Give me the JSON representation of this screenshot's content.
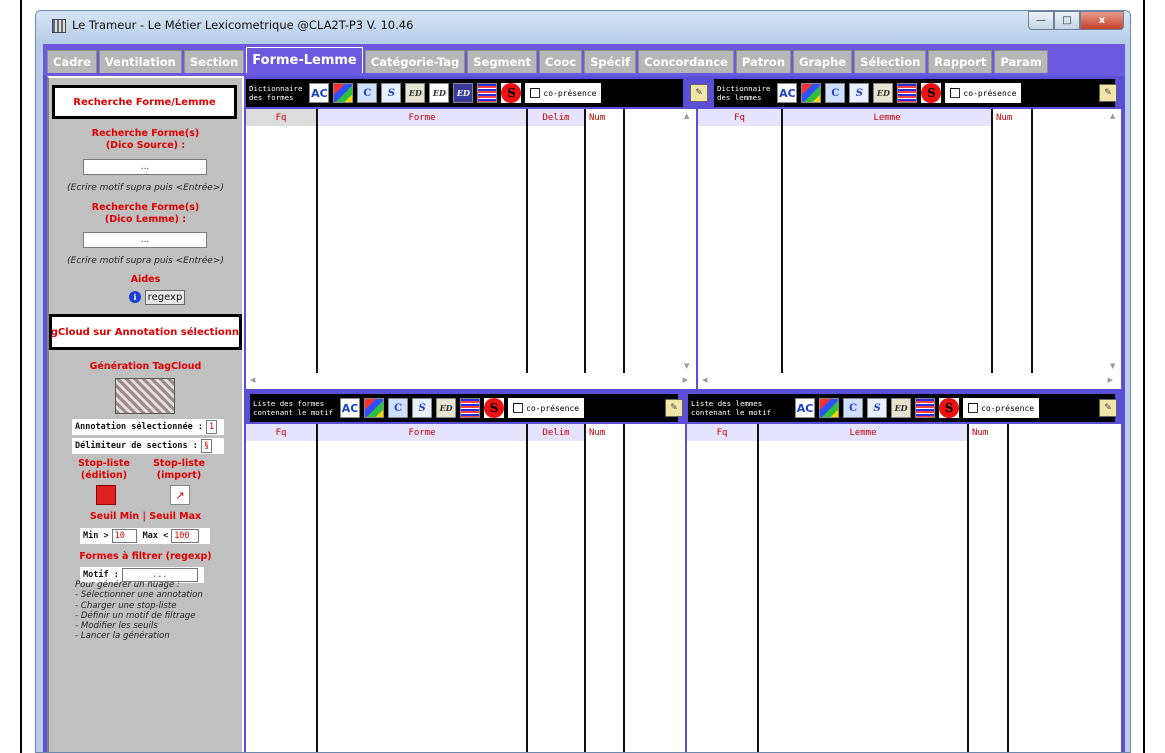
{
  "window": {
    "title": "Le Trameur - Le Métier Lexicometrique @CLA2T-P3 V. 10.46",
    "min": "—",
    "max": "□",
    "close": "x"
  },
  "tabs": [
    {
      "label": "Cadre"
    },
    {
      "label": "Ventilation"
    },
    {
      "label": "Section"
    },
    {
      "label": "Forme-Lemme",
      "active": true
    },
    {
      "label": "Catégorie-Tag"
    },
    {
      "label": "Segment"
    },
    {
      "label": "Cooc"
    },
    {
      "label": "Spécif"
    },
    {
      "label": "Concordance"
    },
    {
      "label": "Patron"
    },
    {
      "label": "Graphe"
    },
    {
      "label": "Sélection"
    },
    {
      "label": "Rapport"
    },
    {
      "label": "Param"
    }
  ],
  "left": {
    "search_title": "Recherche Forme/Lemme",
    "search_forme_label": "Recherche Forme(s)\n(Dico Source) :",
    "search_forme_value": "...",
    "hint1": "(Ecrire motif supra puis <Entrée>)",
    "search_lemme_label": "Recherche Forme(s)\n(Dico Lemme) :",
    "search_lemme_value": "...",
    "hint2": "(Ecrire motif supra puis <Entrée>)",
    "aides": "Aides",
    "regexp": "regexp",
    "tagcloud_title": "TagCloud sur Annotation sélectionnée",
    "generation": "Génération TagCloud",
    "annotation_label": "Annotation sélectionnée :",
    "annotation_value": "1",
    "delim_label": "Délimiteur de sections :",
    "delim_value": "§",
    "stoplist_edit": "Stop-liste\n(édition)",
    "stoplist_import": "Stop-liste\n(import)",
    "seuil": "Seuil Min | Seuil Max",
    "min_label": "Min >",
    "min_value": "10",
    "max_label": "Max <",
    "max_value": "100",
    "filtre": "Formes à filtrer (regexp)",
    "motif_label": "Motif :",
    "motif_value": "...",
    "notes": [
      "Pour générer un nuage :",
      "- Sélectionner une annotation",
      "- Charger une stop-liste",
      "- Définir un motif de filtrage",
      "- Modifier les seuils",
      "- Lancer la génération"
    ]
  },
  "top_left": {
    "label": "Dictionnaire\ndes formes",
    "copresence": "co-présence",
    "headers": [
      "Fq",
      "Forme",
      "Delim",
      "Num"
    ]
  },
  "top_right": {
    "label": "Dictionnaire\ndes lemmes",
    "copresence": "co-présence",
    "headers": [
      "Fq",
      "Lemme",
      "Num"
    ]
  },
  "bottom_left": {
    "label": "Liste des formes\ncontenant le motif",
    "copresence": "co-présence",
    "headers": [
      "Fq",
      "Forme",
      "Delim",
      "Num"
    ]
  },
  "bottom_right": {
    "label": "Liste des lemmes\ncontenant le motif",
    "copresence": "co-présence",
    "headers": [
      "Fq",
      "Lemme",
      "Num"
    ]
  },
  "icons": {
    "ac": "AC",
    "c": "C",
    "s": "S",
    "ed": "ED",
    "stop": "S"
  },
  "colors": {
    "accent": "#5a4fd6",
    "label_red": "#e00000",
    "panel_grey": "#c0c0c0"
  }
}
